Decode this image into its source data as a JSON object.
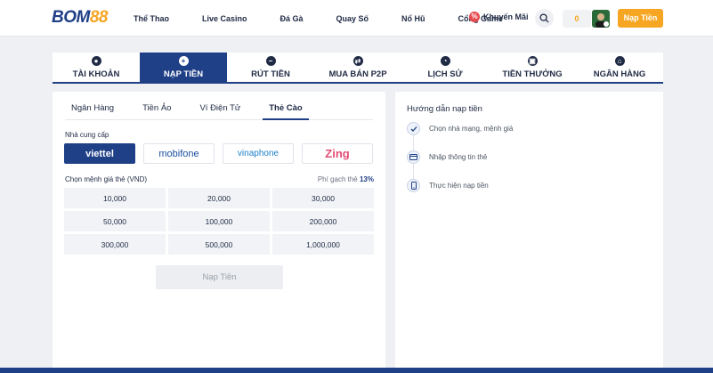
{
  "header": {
    "logo_brand": "BOM",
    "logo_number": "88",
    "nav": [
      "Thể Thao",
      "Live Casino",
      "Đá Gà",
      "Quay Số",
      "Nổ Hũ",
      "Cổng Game"
    ],
    "promo_label": "Khuyến Mãi",
    "balance": "0",
    "deposit_button": "Nạp Tiền"
  },
  "tabs": [
    {
      "label": "TÀI KHOẢN",
      "icon": "user-icon",
      "glyph": "●"
    },
    {
      "label": "NẠP TIỀN",
      "icon": "plus-icon",
      "glyph": "+"
    },
    {
      "label": "RÚT TIỀN",
      "icon": "minus-icon",
      "glyph": "−"
    },
    {
      "label": "MUA BÁN P2P",
      "icon": "exchange-icon",
      "glyph": "⇄"
    },
    {
      "label": "LỊCH SỬ",
      "icon": "clock-icon",
      "glyph": "◔"
    },
    {
      "label": "TIỀN THƯỞNG",
      "icon": "gift-icon",
      "glyph": "▣"
    },
    {
      "label": "NGÂN HÀNG",
      "icon": "bank-icon",
      "glyph": "⌂"
    }
  ],
  "active_tab": "NẠP TIỀN",
  "deposit": {
    "methods": [
      "Ngân Hàng",
      "Tiền Ảo",
      "Ví Điện Tử",
      "Thẻ Cào"
    ],
    "active_method": "Thẻ Cào",
    "provider_label": "Nhà cung cấp",
    "providers": [
      "viettel",
      "mobifone",
      "vinaphone",
      "Zing"
    ],
    "active_provider": "viettel",
    "amount_label": "Chọn mệnh giá thẻ (VND)",
    "fee_label": "Phí gạch thẻ",
    "fee_value": "13%",
    "amounts": [
      "10,000",
      "20,000",
      "30,000",
      "50,000",
      "100,000",
      "200,000",
      "300,000",
      "500,000",
      "1,000,000"
    ],
    "submit_button": "Nạp Tiền"
  },
  "guide": {
    "title": "Hướng dẫn nạp tiền",
    "steps": [
      "Chọn nhà mạng, mệnh giá",
      "Nhập thông tin thẻ",
      "Thực hiện nạp tiền"
    ]
  },
  "colors": {
    "primary": "#1f3f86",
    "accent": "#f6a623",
    "promo": "#e5484d"
  }
}
